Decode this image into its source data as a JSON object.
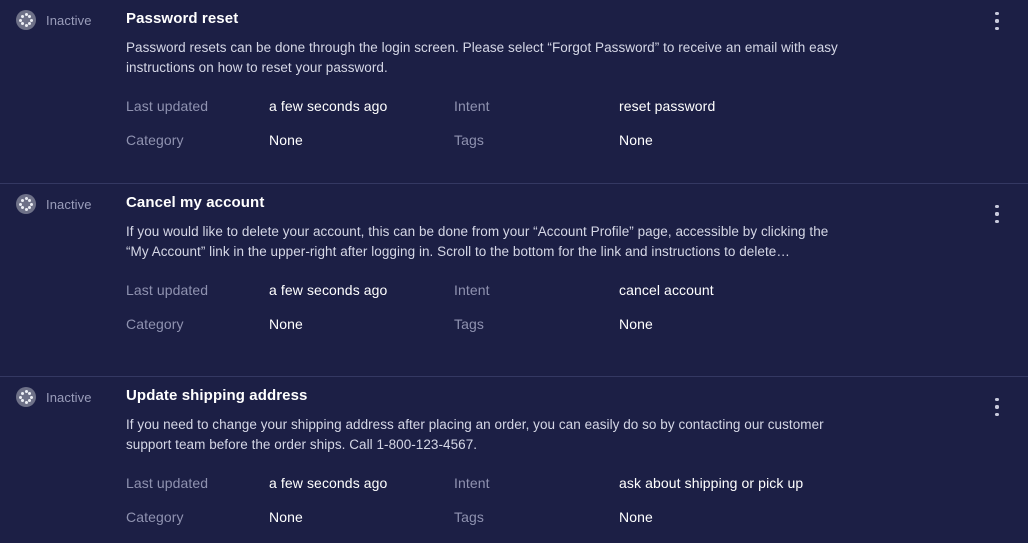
{
  "theme": {
    "background": "#1c1f45",
    "divider": "#343862",
    "title_color": "#ffffff",
    "description_color": "#d5d7e6",
    "label_color": "#8f92b0",
    "status_label_color": "#9a9dba",
    "status_icon_color": "#6e7188"
  },
  "labels": {
    "last_updated": "Last updated",
    "intent": "Intent",
    "category": "Category",
    "tags": "Tags"
  },
  "icons": {
    "status": "pending-circle-icon",
    "menu": "more-vertical-icon"
  },
  "cards": [
    {
      "status": "Inactive",
      "title": "Password reset",
      "description": "Password resets can be done through the login screen. Please select “Forgot Password” to receive an email with easy instructions on how to reset your password.",
      "last_updated": "a few seconds ago",
      "intent": "reset password",
      "category": "None",
      "tags": "None"
    },
    {
      "status": "Inactive",
      "title": "Cancel my account",
      "description": "If you would like to delete your account, this can be done from your “Account Profile” page, accessible by clicking the “My Account” link in the upper-right after logging in. Scroll to the bottom for the link and instructions to delete…",
      "last_updated": "a few seconds ago",
      "intent": "cancel account",
      "category": "None",
      "tags": "None"
    },
    {
      "status": "Inactive",
      "title": "Update shipping address",
      "description": "If you need to change your shipping address after placing an order, you can easily do so by contacting our customer support team before the order ships. Call 1-800-123-4567.",
      "last_updated": "a few seconds ago",
      "intent": "ask about shipping or pick up",
      "category": "None",
      "tags": "None"
    }
  ]
}
